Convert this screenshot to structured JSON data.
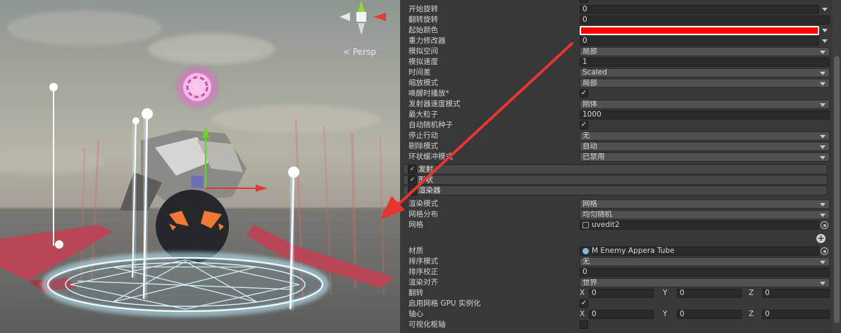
{
  "viewport": {
    "projection_label": "< Persp",
    "gizmo_axes": [
      "y-axis",
      "x-axis",
      "z-axis"
    ]
  },
  "inspector": {
    "rows_top": [
      {
        "label": "开始旋转",
        "type": "numdrop",
        "value": "0"
      },
      {
        "label": "翻转旋转",
        "type": "text",
        "value": "0"
      },
      {
        "label": "起始颜色",
        "type": "color",
        "value": "#ff0000"
      },
      {
        "label": "重力修改器",
        "type": "numdrop",
        "value": "0"
      },
      {
        "label": "模拟空间",
        "type": "drop",
        "value": "局部"
      },
      {
        "label": "模拟速度",
        "type": "text",
        "value": "1"
      },
      {
        "label": "时间差",
        "type": "drop",
        "value": "Scaled"
      },
      {
        "label": "缩放模式",
        "type": "drop",
        "value": "局部"
      },
      {
        "label": "唤醒时播放*",
        "type": "check",
        "value": "✓"
      },
      {
        "label": "发射器速度模式",
        "type": "drop",
        "value": "刚体"
      },
      {
        "label": "最大粒子",
        "type": "text",
        "value": "1000"
      },
      {
        "label": "自动随机种子",
        "type": "check",
        "value": "✓"
      },
      {
        "label": "停止行动",
        "type": "drop",
        "value": "无"
      },
      {
        "label": "剔除模式",
        "type": "drop",
        "value": "自动"
      },
      {
        "label": "环状缓冲模式",
        "type": "drop",
        "value": "已禁用"
      }
    ],
    "modules": [
      {
        "label": "发射",
        "checked": "✓"
      },
      {
        "label": "形状",
        "checked": "✓"
      },
      {
        "label": "渲染器",
        "checked": ""
      }
    ],
    "renderer_rows": [
      {
        "label": "渲染模式",
        "type": "drop",
        "value": "网格"
      },
      {
        "label": "网格分布",
        "type": "drop",
        "value": "均匀随机"
      },
      {
        "label": "网格",
        "type": "object",
        "value": "uvedit2"
      },
      {
        "label": "材质",
        "type": "object",
        "value": "M Enemy Appera Tube"
      },
      {
        "label": "排序模式",
        "type": "drop",
        "value": "无"
      },
      {
        "label": "排序校正",
        "type": "text",
        "value": "0"
      },
      {
        "label": "渲染对齐",
        "type": "drop",
        "value": "世界"
      },
      {
        "label": "翻转",
        "type": "xyz",
        "x": "0",
        "y": "0",
        "z": "0"
      },
      {
        "label": "启用网格 GPU 实例化",
        "type": "check",
        "value": "✓"
      },
      {
        "label": "轴心",
        "type": "xyz",
        "x": "0",
        "y": "0",
        "z": "0"
      },
      {
        "label": "可视化枢轴",
        "type": "check",
        "value": ""
      }
    ],
    "xyz_labels": {
      "x": "X",
      "y": "Y",
      "z": "Z"
    },
    "add_button_label": "+"
  },
  "colors": {
    "inspector_bg": "#383838",
    "field_bg": "#2a2a2a",
    "annotation_arrow": "#e8352f",
    "glow": "#d8f4ff"
  }
}
